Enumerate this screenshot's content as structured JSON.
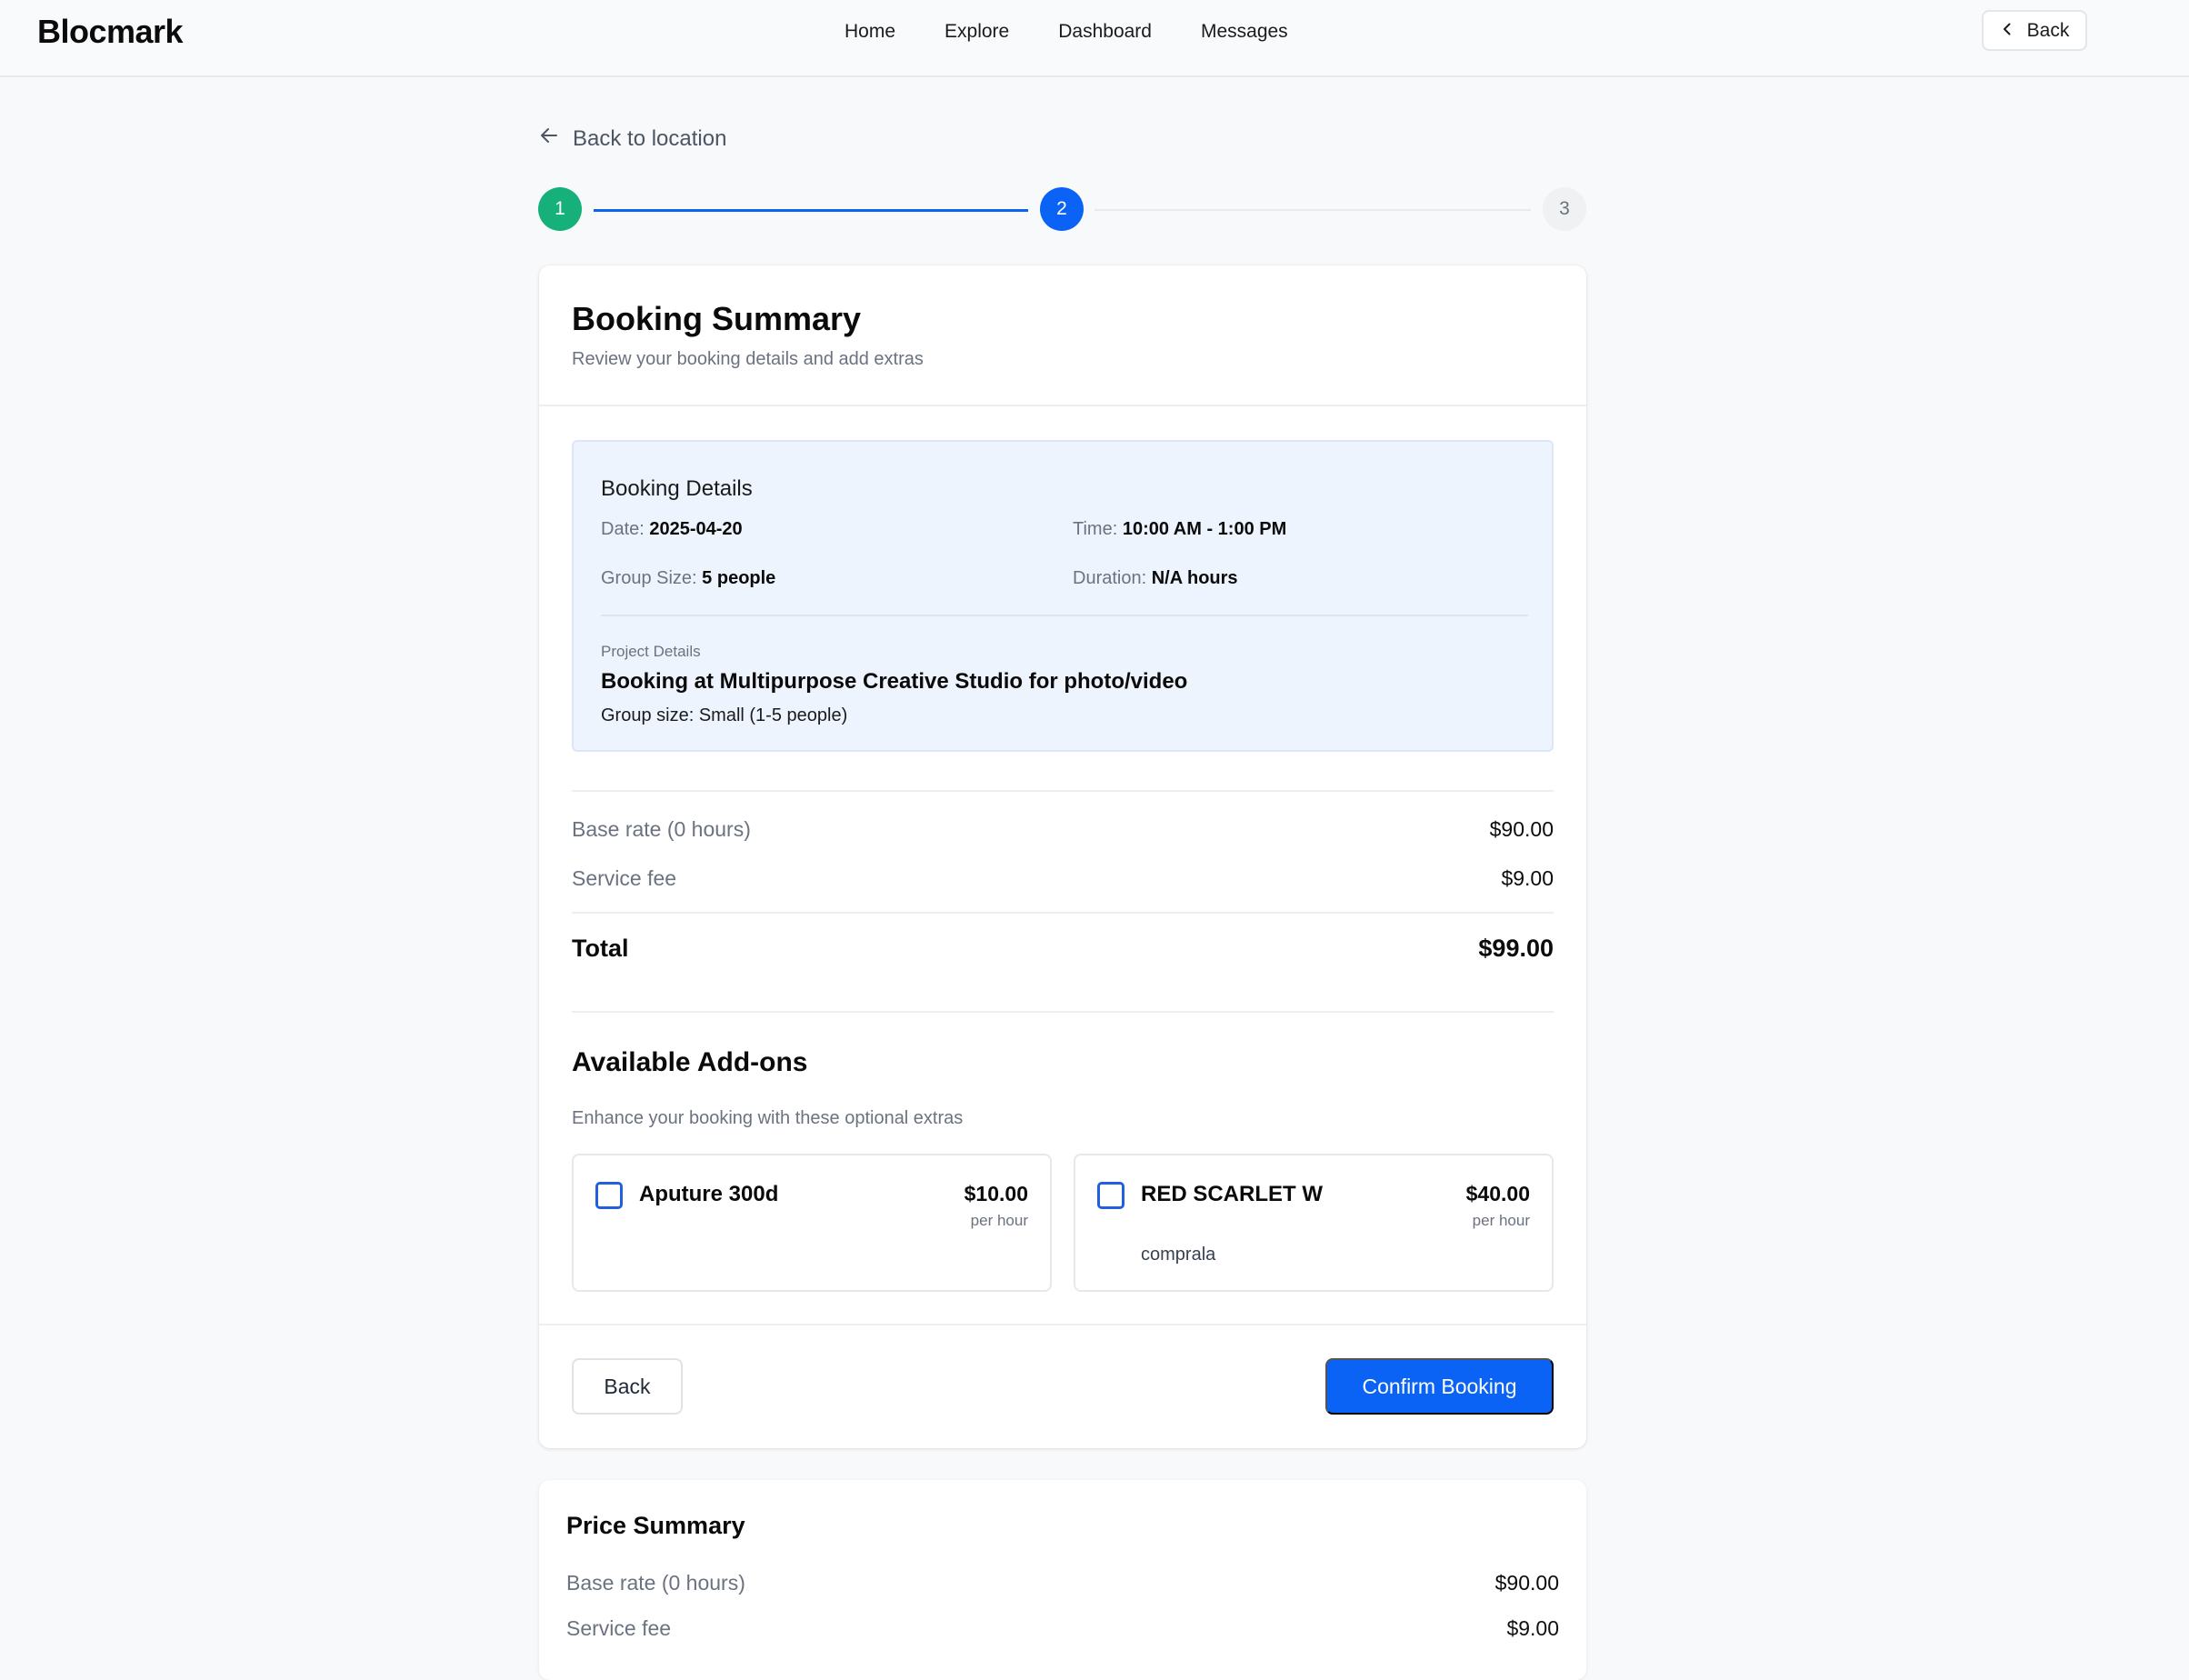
{
  "header": {
    "brand": "Blocmark",
    "nav": [
      "Home",
      "Explore",
      "Dashboard",
      "Messages"
    ],
    "back_label": "Back"
  },
  "back_link": "Back to location",
  "stepper": {
    "steps": [
      "1",
      "2",
      "3"
    ],
    "current": 2
  },
  "booking_summary": {
    "title": "Booking Summary",
    "subtitle": "Review your booking details and add extras",
    "details": {
      "title": "Booking Details",
      "date_label": "Date:",
      "date_value": "2025-04-20",
      "time_label": "Time:",
      "time_value": "10:00 AM - 1:00 PM",
      "group_label": "Group Size:",
      "group_value": "5 people",
      "duration_label": "Duration:",
      "duration_value": "N/A hours",
      "project_label": "Project Details",
      "project_title": "Booking at Multipurpose Creative Studio for photo/video",
      "project_group": "Group size: Small (1-5 people)"
    },
    "pricing": {
      "base_label": "Base rate (0 hours)",
      "base_value": "$90.00",
      "fee_label": "Service fee",
      "fee_value": "$9.00",
      "total_label": "Total",
      "total_value": "$99.00"
    },
    "addons": {
      "title": "Available Add-ons",
      "subtitle": "Enhance your booking with these optional extras",
      "items": [
        {
          "name": "Aputure 300d",
          "price": "$10.00",
          "unit": "per hour",
          "description": "",
          "checked": false
        },
        {
          "name": "RED SCARLET W",
          "price": "$40.00",
          "unit": "per hour",
          "description": "comprala",
          "checked": false
        }
      ]
    },
    "buttons": {
      "back": "Back",
      "confirm": "Confirm Booking"
    }
  },
  "price_summary": {
    "title": "Price Summary",
    "base_label": "Base rate (0 hours)",
    "base_value": "$90.00",
    "fee_label": "Service fee",
    "fee_value": "$9.00"
  },
  "colors": {
    "accent": "#0b63f6",
    "step_complete": "#16b07a",
    "details_bg": "#eef4fe"
  },
  "icons": [
    "arrow-left-icon",
    "chevron-left-icon"
  ]
}
